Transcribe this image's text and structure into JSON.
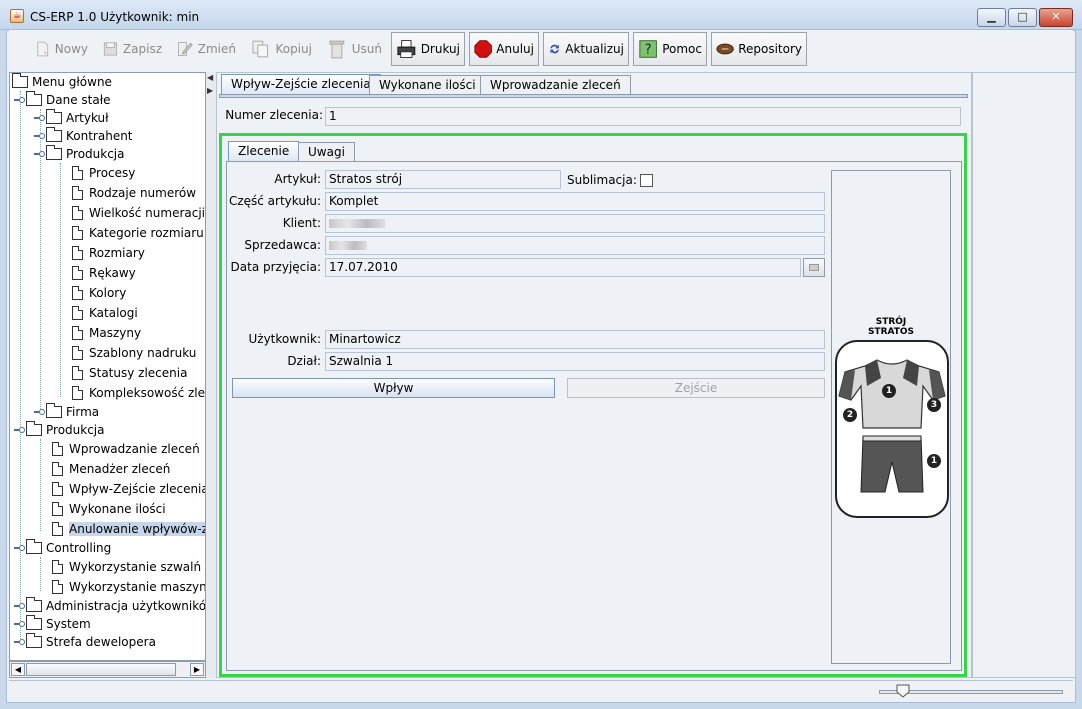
{
  "window": {
    "title": "CS-ERP 1.0  Użytkownik: min",
    "minimize": "▁",
    "maximize": "□",
    "close": "✕"
  },
  "toolbar": {
    "new": "Nowy",
    "save": "Zapisz",
    "edit": "Zmień",
    "copy": "Kopiuj",
    "delete": "Usuń",
    "print": "Drukuj",
    "cancel": "Anuluj",
    "refresh": "Aktualizuj",
    "help": "Pomoc",
    "repos": "Repository"
  },
  "sidebar": {
    "root": "Menu główne",
    "dane_stale": "Dane stałe",
    "artykul": "Artykuł",
    "kontrahent": "Kontrahent",
    "produkcja_group": "Produkcja",
    "items": [
      "Procesy",
      "Rodzaje numerów",
      "Wielkość numeracji",
      "Kategorie rozmiaru",
      "Rozmiary",
      "Rękawy",
      "Kolory",
      "Katalogi",
      "Maszyny",
      "Szablony nadruku",
      "Statusy zlecenia",
      "Kompleksowość zleceń"
    ],
    "firma": "Firma",
    "produkcja": "Produkcja",
    "produkcja_items": [
      "Wprowadzanie zleceń",
      "Menadżer zleceń",
      "Wpływ-Zejście zlecenia",
      "Wykonane ilości",
      "Anulowanie wpływów-zejść"
    ],
    "controlling": "Controlling",
    "controlling_items": [
      "Wykorzystanie szwalń",
      "Wykorzystanie maszyn"
    ],
    "admin": "Administracja użytkowników",
    "system": "System",
    "dev": "Strefa dewelopera"
  },
  "tabs": [
    "Wpływ-Zejście zlecenia",
    "Wykonane ilości",
    "Wprowadzanie zleceń"
  ],
  "order": {
    "number_label": "Numer zlecenia:",
    "number_value": "1"
  },
  "subtabs": [
    "Zlecenie",
    "Uwagi"
  ],
  "form": {
    "article_label": "Artykuł:",
    "article_value": "Stratos strój",
    "sublimation_label": "Sublimacja:",
    "part_label": "Część artykułu:",
    "part_value": "Komplet",
    "client_label": "Klient:",
    "seller_label": "Sprzedawca:",
    "date_label": "Data przyjęcia:",
    "date_value": "17.07.2010",
    "user_label": "Użytkownik:",
    "user_value": "Minartowicz",
    "dept_label": "Dział:",
    "dept_value": "Szwalnia 1",
    "in_button": "Wpływ",
    "out_button": "Zejście"
  },
  "preview": {
    "line1": "STRÓJ",
    "line2": "STRATOS",
    "badge_1": "1",
    "badge_2": "2",
    "badge_3": "3"
  }
}
